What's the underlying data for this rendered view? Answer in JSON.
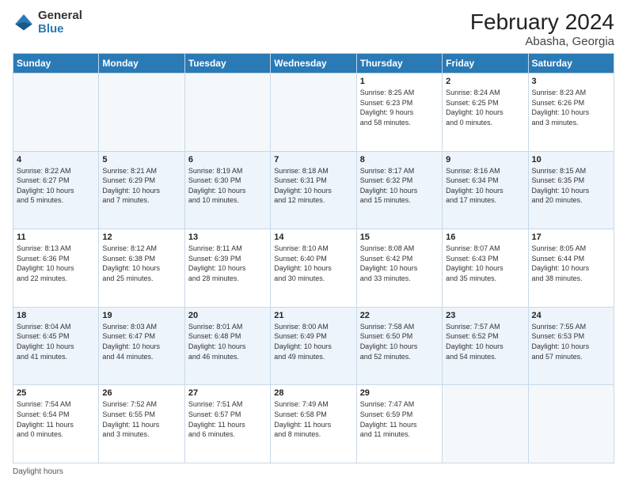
{
  "logo": {
    "general": "General",
    "blue": "Blue"
  },
  "title": "February 2024",
  "subtitle": "Abasha, Georgia",
  "days_header": [
    "Sunday",
    "Monday",
    "Tuesday",
    "Wednesday",
    "Thursday",
    "Friday",
    "Saturday"
  ],
  "weeks": [
    [
      {
        "num": "",
        "info": ""
      },
      {
        "num": "",
        "info": ""
      },
      {
        "num": "",
        "info": ""
      },
      {
        "num": "",
        "info": ""
      },
      {
        "num": "1",
        "info": "Sunrise: 8:25 AM\nSunset: 6:23 PM\nDaylight: 9 hours\nand 58 minutes."
      },
      {
        "num": "2",
        "info": "Sunrise: 8:24 AM\nSunset: 6:25 PM\nDaylight: 10 hours\nand 0 minutes."
      },
      {
        "num": "3",
        "info": "Sunrise: 8:23 AM\nSunset: 6:26 PM\nDaylight: 10 hours\nand 3 minutes."
      }
    ],
    [
      {
        "num": "4",
        "info": "Sunrise: 8:22 AM\nSunset: 6:27 PM\nDaylight: 10 hours\nand 5 minutes."
      },
      {
        "num": "5",
        "info": "Sunrise: 8:21 AM\nSunset: 6:29 PM\nDaylight: 10 hours\nand 7 minutes."
      },
      {
        "num": "6",
        "info": "Sunrise: 8:19 AM\nSunset: 6:30 PM\nDaylight: 10 hours\nand 10 minutes."
      },
      {
        "num": "7",
        "info": "Sunrise: 8:18 AM\nSunset: 6:31 PM\nDaylight: 10 hours\nand 12 minutes."
      },
      {
        "num": "8",
        "info": "Sunrise: 8:17 AM\nSunset: 6:32 PM\nDaylight: 10 hours\nand 15 minutes."
      },
      {
        "num": "9",
        "info": "Sunrise: 8:16 AM\nSunset: 6:34 PM\nDaylight: 10 hours\nand 17 minutes."
      },
      {
        "num": "10",
        "info": "Sunrise: 8:15 AM\nSunset: 6:35 PM\nDaylight: 10 hours\nand 20 minutes."
      }
    ],
    [
      {
        "num": "11",
        "info": "Sunrise: 8:13 AM\nSunset: 6:36 PM\nDaylight: 10 hours\nand 22 minutes."
      },
      {
        "num": "12",
        "info": "Sunrise: 8:12 AM\nSunset: 6:38 PM\nDaylight: 10 hours\nand 25 minutes."
      },
      {
        "num": "13",
        "info": "Sunrise: 8:11 AM\nSunset: 6:39 PM\nDaylight: 10 hours\nand 28 minutes."
      },
      {
        "num": "14",
        "info": "Sunrise: 8:10 AM\nSunset: 6:40 PM\nDaylight: 10 hours\nand 30 minutes."
      },
      {
        "num": "15",
        "info": "Sunrise: 8:08 AM\nSunset: 6:42 PM\nDaylight: 10 hours\nand 33 minutes."
      },
      {
        "num": "16",
        "info": "Sunrise: 8:07 AM\nSunset: 6:43 PM\nDaylight: 10 hours\nand 35 minutes."
      },
      {
        "num": "17",
        "info": "Sunrise: 8:05 AM\nSunset: 6:44 PM\nDaylight: 10 hours\nand 38 minutes."
      }
    ],
    [
      {
        "num": "18",
        "info": "Sunrise: 8:04 AM\nSunset: 6:45 PM\nDaylight: 10 hours\nand 41 minutes."
      },
      {
        "num": "19",
        "info": "Sunrise: 8:03 AM\nSunset: 6:47 PM\nDaylight: 10 hours\nand 44 minutes."
      },
      {
        "num": "20",
        "info": "Sunrise: 8:01 AM\nSunset: 6:48 PM\nDaylight: 10 hours\nand 46 minutes."
      },
      {
        "num": "21",
        "info": "Sunrise: 8:00 AM\nSunset: 6:49 PM\nDaylight: 10 hours\nand 49 minutes."
      },
      {
        "num": "22",
        "info": "Sunrise: 7:58 AM\nSunset: 6:50 PM\nDaylight: 10 hours\nand 52 minutes."
      },
      {
        "num": "23",
        "info": "Sunrise: 7:57 AM\nSunset: 6:52 PM\nDaylight: 10 hours\nand 54 minutes."
      },
      {
        "num": "24",
        "info": "Sunrise: 7:55 AM\nSunset: 6:53 PM\nDaylight: 10 hours\nand 57 minutes."
      }
    ],
    [
      {
        "num": "25",
        "info": "Sunrise: 7:54 AM\nSunset: 6:54 PM\nDaylight: 11 hours\nand 0 minutes."
      },
      {
        "num": "26",
        "info": "Sunrise: 7:52 AM\nSunset: 6:55 PM\nDaylight: 11 hours\nand 3 minutes."
      },
      {
        "num": "27",
        "info": "Sunrise: 7:51 AM\nSunset: 6:57 PM\nDaylight: 11 hours\nand 6 minutes."
      },
      {
        "num": "28",
        "info": "Sunrise: 7:49 AM\nSunset: 6:58 PM\nDaylight: 11 hours\nand 8 minutes."
      },
      {
        "num": "29",
        "info": "Sunrise: 7:47 AM\nSunset: 6:59 PM\nDaylight: 11 hours\nand 11 minutes."
      },
      {
        "num": "",
        "info": ""
      },
      {
        "num": "",
        "info": ""
      }
    ]
  ],
  "footer": "Daylight hours"
}
